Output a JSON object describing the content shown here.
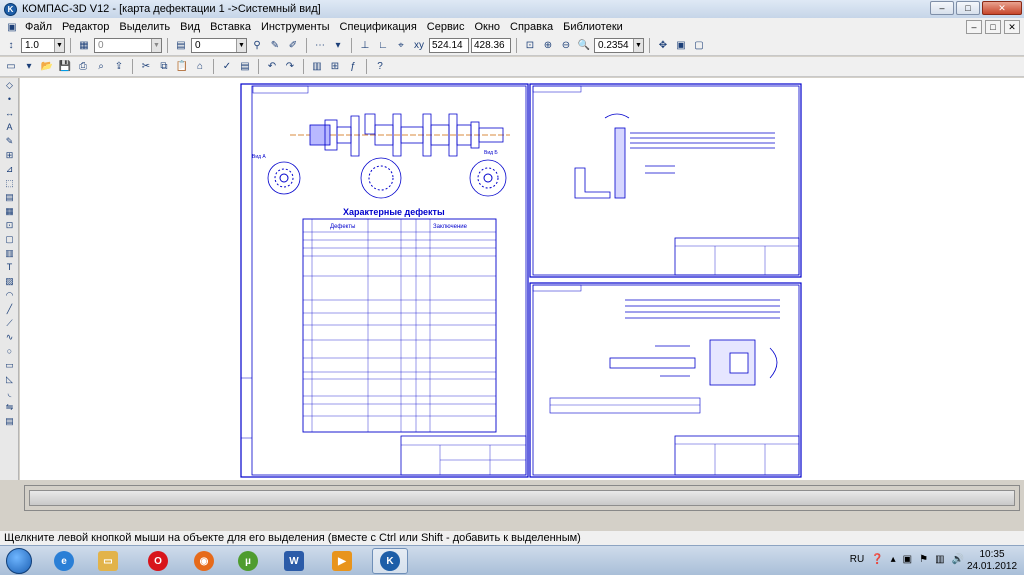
{
  "window": {
    "title": "КОМПАС-3D V12 - [карта дефектации 1 ->Системный вид]",
    "buttons": {
      "minimize": "–",
      "maximize": "□",
      "close": "✕"
    }
  },
  "menu": {
    "items": [
      "Файл",
      "Редактор",
      "Выделить",
      "Вид",
      "Вставка",
      "Инструменты",
      "Спецификация",
      "Сервис",
      "Окно",
      "Справка",
      "Библиотеки"
    ]
  },
  "toolbar1": {
    "line_scale": "1.0",
    "layer": "0",
    "style": "0",
    "coord_x": "524.14",
    "coord_y": "428.36",
    "zoom": "0.2354"
  },
  "drawing": {
    "table_title": "Характерные дефекты",
    "table_headers": [
      "Дефекты",
      "Заключение"
    ],
    "view_a": "Вид А",
    "view_b": "Вид Б"
  },
  "statusbar": {
    "text": "Щелкните левой кнопкой мыши на объекте для его выделения (вместе с Ctrl или Shift - добавить к выделенным)"
  },
  "taskbar": {
    "lang": "RU",
    "time": "10:35",
    "date": "24.01.2012"
  }
}
